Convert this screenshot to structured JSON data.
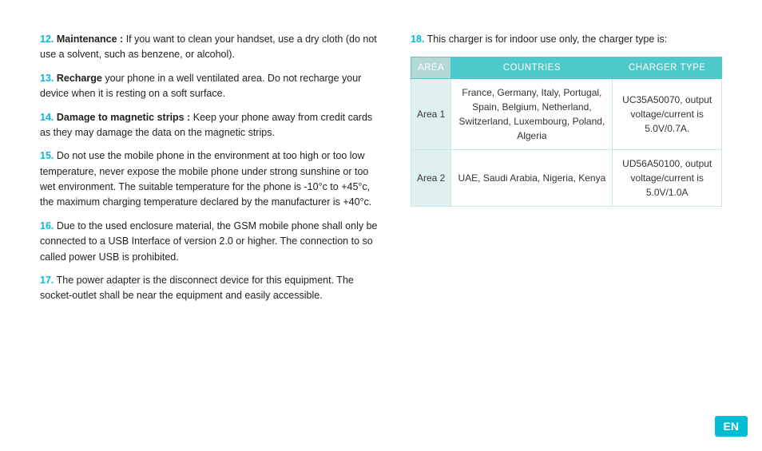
{
  "left": {
    "items": [
      {
        "num": "12.",
        "bold": "Maintenance :",
        "text": " If you want to clean your handset, use a dry cloth (do not use a solvent, such as benzene, or alcohol)."
      },
      {
        "num": "13.",
        "bold": "Recharge",
        "text": " your phone in a well ventilated area. Do not recharge your device when it is resting on a soft surface."
      },
      {
        "num": "14.",
        "bold": "Damage to magnetic strips :",
        "text": " Keep your phone away from credit cards as they may damage the data on the magnetic strips."
      },
      {
        "num": "15.",
        "bold": "",
        "text": " Do not use the mobile phone in the environment at too high or too low temperature, never expose the mobile phone under strong sunshine or too wet environment. The suitable temperature for the phone is -10°c to +45°c, the maximum charging temperature declared by the manufacturer is +40°c."
      },
      {
        "num": "16.",
        "bold": "",
        "text": " Due to the used enclosure material, the GSM mobile phone shall only be connected to a USB Interface of version 2.0 or higher. The connection to so called power USB is prohibited."
      },
      {
        "num": "17.",
        "bold": "",
        "text": " The power adapter is the disconnect device for this equipment. The socket-outlet shall be near the equipment and easily accessible."
      }
    ]
  },
  "right": {
    "intro_num": "18.",
    "intro_text": " This charger is for indoor use only, the charger type is:",
    "table": {
      "headers": [
        "AREA",
        "COUNTRIES",
        "CHARGER TYPE"
      ],
      "rows": [
        {
          "area": "Area 1",
          "countries": "France, Germany, Italy, Portugal, Spain, Belgium, Netherland, Switzerland, Luxembourg, Poland, Algeria",
          "charger_type": "UC35A50070, output voltage/current is 5.0V/0.7A."
        },
        {
          "area": "Area 2",
          "countries": "UAE, Saudi Arabia, Nigeria, Kenya",
          "charger_type": "UD56A50100, output voltage/current is 5.0V/1.0A"
        }
      ]
    }
  },
  "badge": {
    "label": "EN"
  }
}
